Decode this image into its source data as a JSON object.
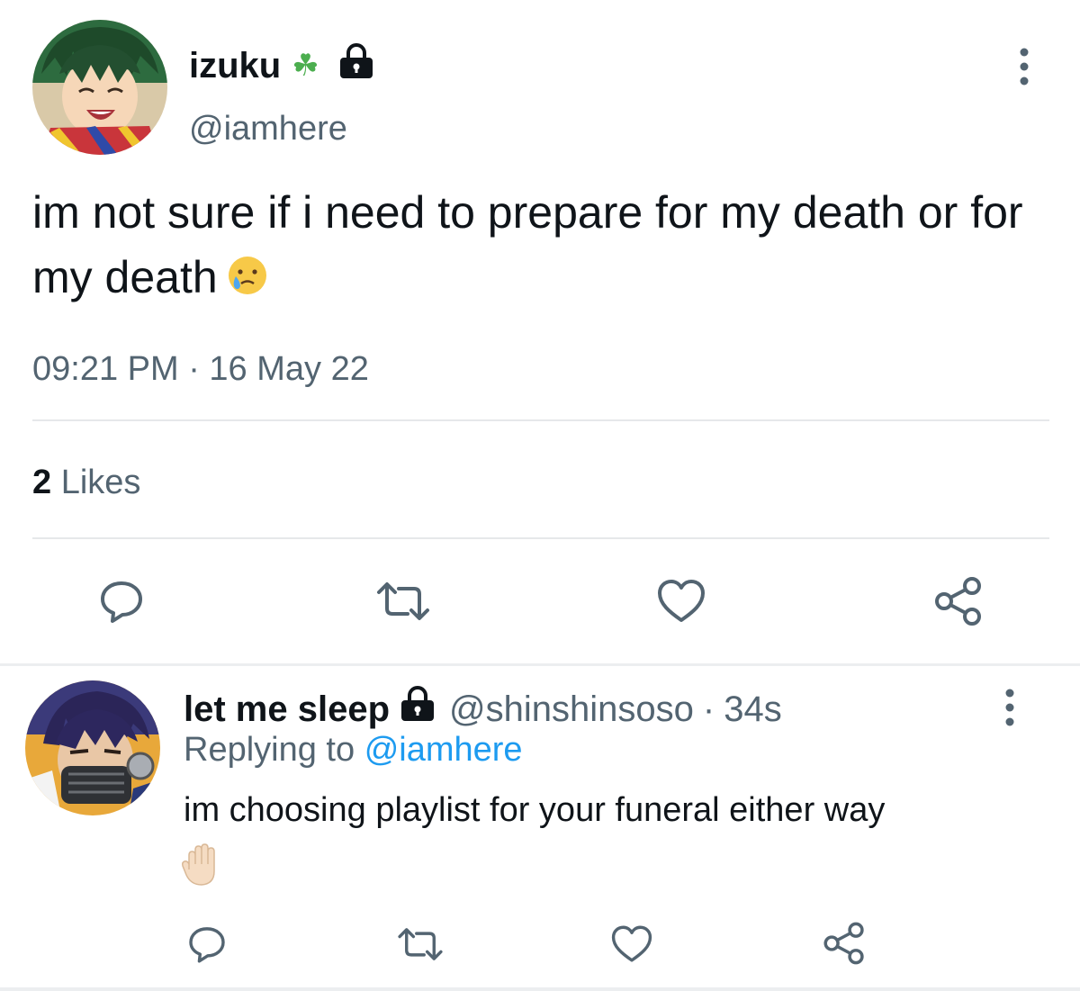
{
  "main_tweet": {
    "author": {
      "display_name": "izuku",
      "name_emoji": "☘",
      "handle": "@iamhere",
      "avatar_icon": "anime-boy-green-hair-avatar"
    },
    "text": "im not sure if i need to prepare for my death or for my death",
    "text_emoji": "sad-tear-face-emoji",
    "timestamp": "09:21 PM · 16 May 22",
    "likes_count": "2",
    "likes_label": "Likes",
    "actions": [
      "reply-icon",
      "retweet-icon",
      "like-icon",
      "share-icon"
    ]
  },
  "reply": {
    "author": {
      "display_name": "let me sleep",
      "handle": "@shinshinsoso",
      "separator": "·",
      "time": "34s",
      "avatar_icon": "anime-purple-hair-mask-avatar"
    },
    "replying_prefix": "Replying to",
    "replying_to": "@iamhere",
    "text": "im choosing playlist for your funeral either way",
    "text_emoji": "raised-hand-emoji",
    "actions": [
      "reply-icon",
      "retweet-icon",
      "like-icon",
      "share-icon"
    ]
  },
  "colors": {
    "text_primary": "#0f1419",
    "text_secondary": "#536471",
    "link": "#1d9bf0",
    "divider": "#e6e8ea",
    "icon": "#536471"
  }
}
